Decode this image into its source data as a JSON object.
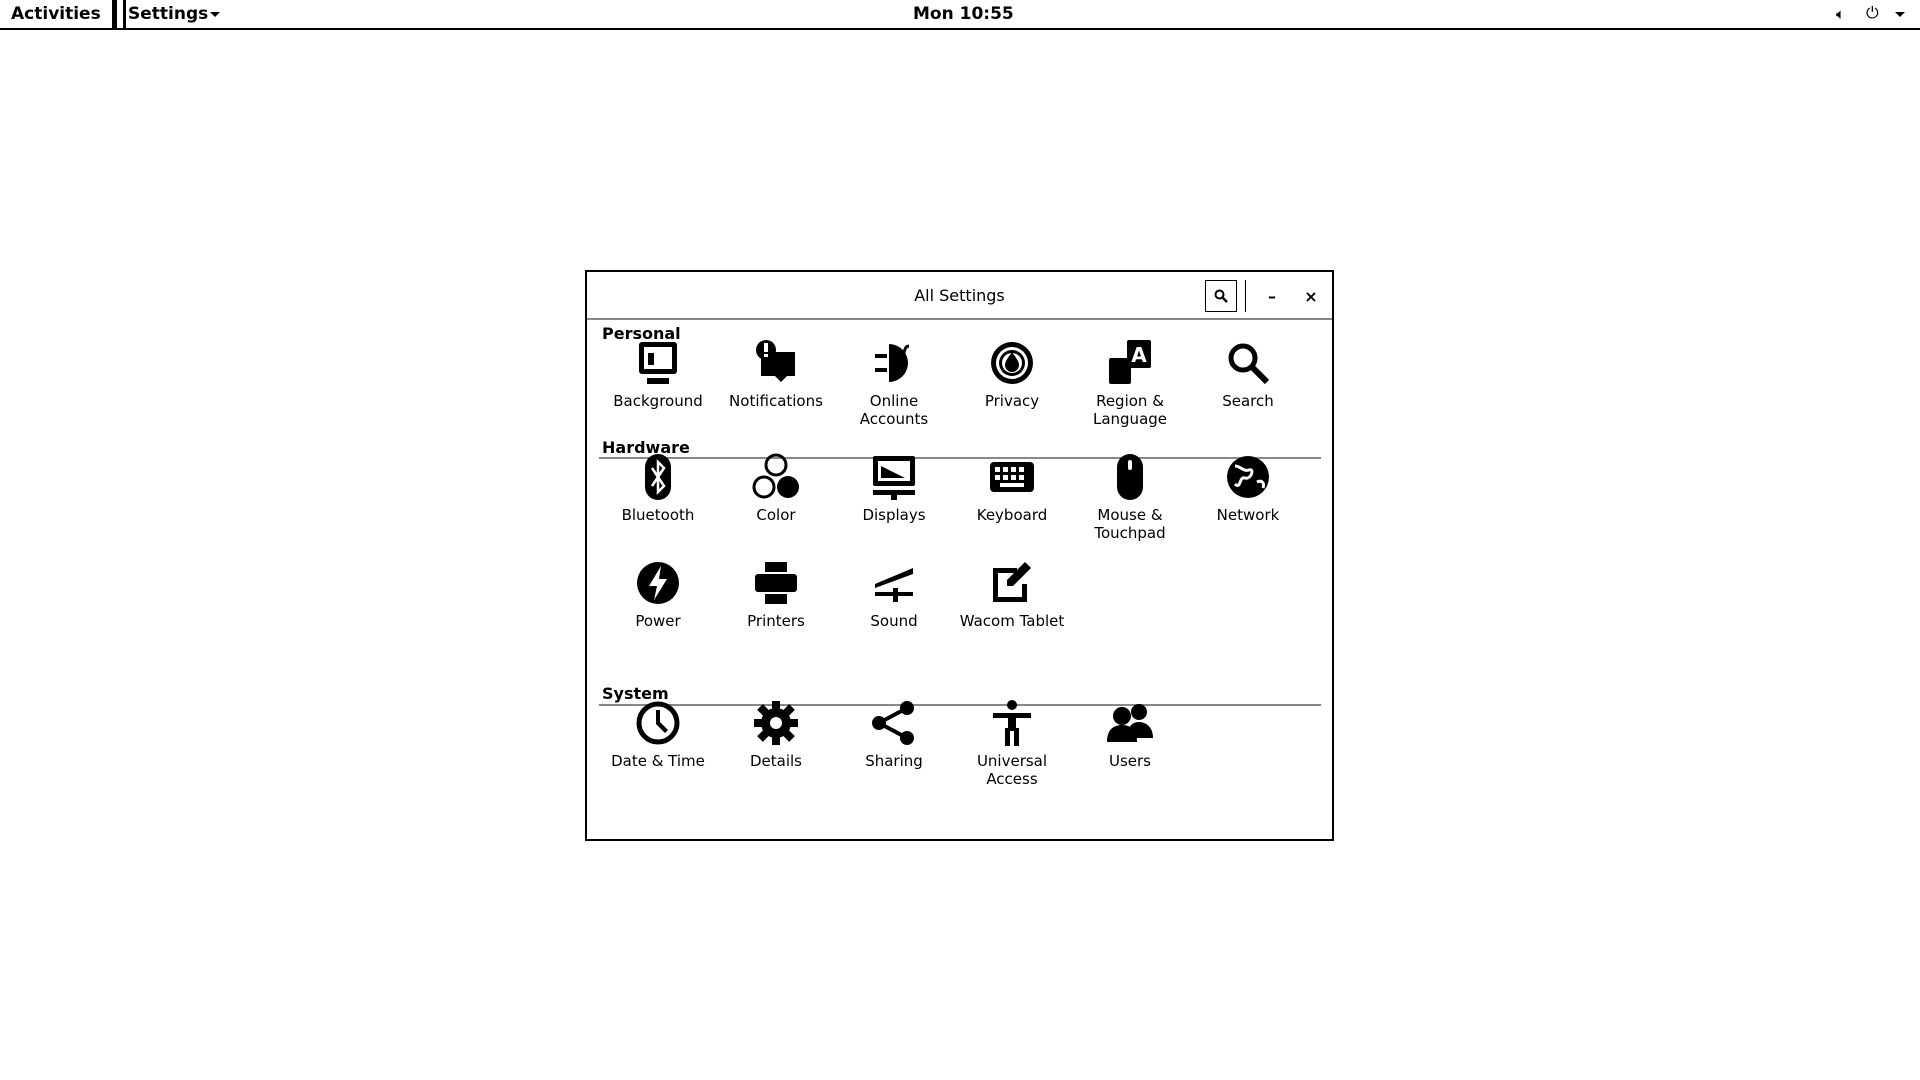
{
  "topbar": {
    "activities": "Activities",
    "app_menu": "Settings",
    "clock": "Mon 10:55"
  },
  "window": {
    "title": "All Settings"
  },
  "sections": [
    {
      "label": "Personal",
      "items": [
        {
          "label": "Background",
          "icon": "background-icon"
        },
        {
          "label": "Notifications",
          "icon": "notifications-icon"
        },
        {
          "label": "Online Accounts",
          "icon": "online-accounts-icon"
        },
        {
          "label": "Privacy",
          "icon": "privacy-icon"
        },
        {
          "label": "Region & Language",
          "icon": "region-language-icon"
        },
        {
          "label": "Search",
          "icon": "search-icon"
        }
      ]
    },
    {
      "label": "Hardware",
      "items": [
        {
          "label": "Bluetooth",
          "icon": "bluetooth-icon"
        },
        {
          "label": "Color",
          "icon": "color-icon"
        },
        {
          "label": "Displays",
          "icon": "displays-icon"
        },
        {
          "label": "Keyboard",
          "icon": "keyboard-icon"
        },
        {
          "label": "Mouse & Touchpad",
          "icon": "mouse-icon"
        },
        {
          "label": "Network",
          "icon": "network-icon"
        },
        {
          "label": "Power",
          "icon": "power-icon"
        },
        {
          "label": "Printers",
          "icon": "printer-icon"
        },
        {
          "label": "Sound",
          "icon": "sound-icon"
        },
        {
          "label": "Wacom Tablet",
          "icon": "wacom-tablet-icon"
        }
      ]
    },
    {
      "label": "System",
      "items": [
        {
          "label": "Date & Time",
          "icon": "clock-icon"
        },
        {
          "label": "Details",
          "icon": "gear-icon"
        },
        {
          "label": "Sharing",
          "icon": "share-icon"
        },
        {
          "label": "Universal Access",
          "icon": "accessibility-icon"
        },
        {
          "label": "Users",
          "icon": "users-icon"
        }
      ]
    }
  ]
}
